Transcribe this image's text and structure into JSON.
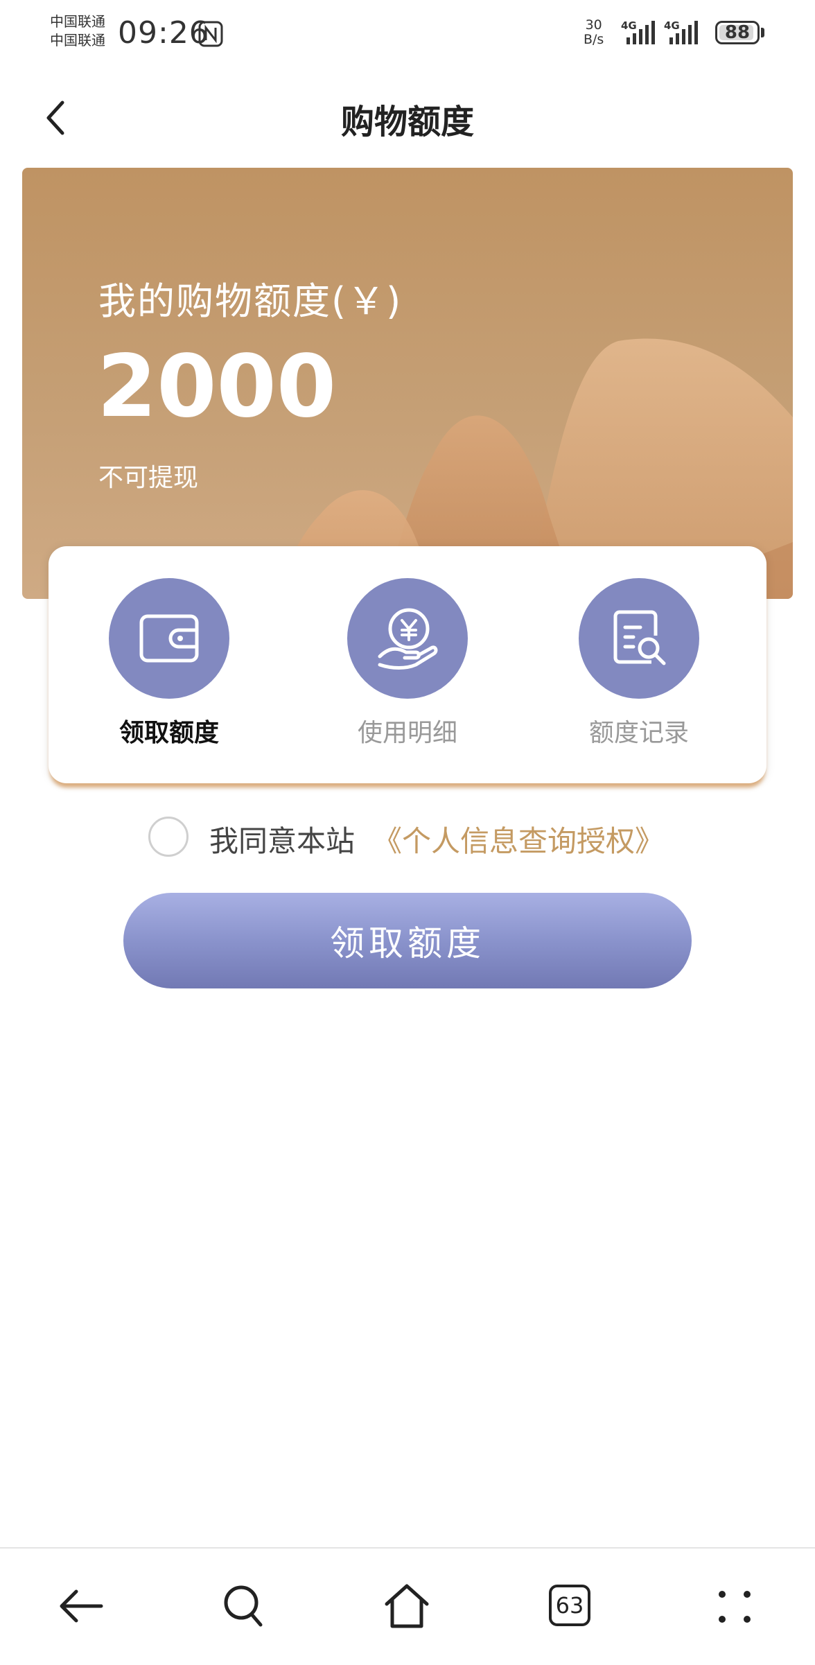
{
  "status_bar": {
    "carrier_1": "中国联通",
    "carrier_2": "中国联通",
    "time": "09:26",
    "speed_value": "30",
    "speed_unit": "B/s",
    "network_1": "4G",
    "network_2": "4G",
    "battery": "88"
  },
  "header": {
    "title": "购物额度"
  },
  "banner": {
    "label": "我的购物额度(￥)",
    "amount": "2000",
    "note": "不可提现"
  },
  "actions": [
    {
      "label": "领取额度",
      "icon": "wallet-icon",
      "active": true
    },
    {
      "label": "使用明细",
      "icon": "yen-hand-icon",
      "active": false
    },
    {
      "label": "额度记录",
      "icon": "document-search-icon",
      "active": false
    }
  ],
  "agreement": {
    "text": "我同意本站",
    "link": "《个人信息查询授权》",
    "checked": false
  },
  "claim_button": {
    "label": "领取额度"
  },
  "bottom_nav": {
    "items": [
      "back-icon",
      "search-icon",
      "home-icon",
      "tabs-icon",
      "more-icon"
    ],
    "tab_count": "63"
  },
  "colors": {
    "banner": "#c59f75",
    "accent_purple": "#8289c0",
    "link_gold": "#c49a62",
    "card_shadow": "#d6a068"
  }
}
